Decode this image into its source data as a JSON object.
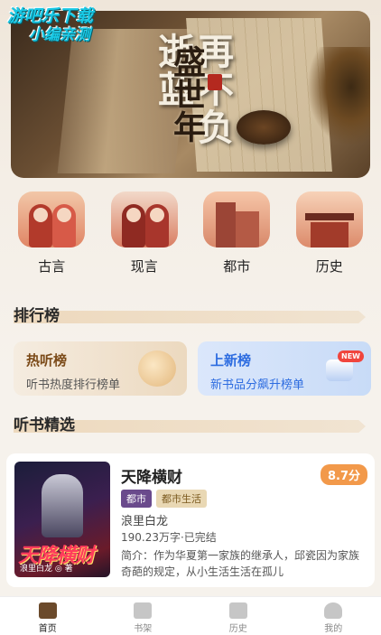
{
  "watermark": {
    "line1": "游吧乐下载",
    "line2": "小编亲测"
  },
  "banner": {
    "title_part1": "再不负",
    "title_part2": "逝",
    "title_part3": "蓝",
    "title_vertical_2": "盛世年"
  },
  "categories": [
    {
      "label": "古言",
      "icon": "ancient-couple-thumb"
    },
    {
      "label": "现言",
      "icon": "modern-couple-thumb"
    },
    {
      "label": "都市",
      "icon": "city-buildings-thumb"
    },
    {
      "label": "历史",
      "icon": "palace-thumb"
    }
  ],
  "sections": {
    "ranking": "排行榜",
    "picks": "听书精选"
  },
  "ranking_cards": [
    {
      "title": "热听榜",
      "subtitle": "听书热度排行榜单",
      "icon": "trophy-icon"
    },
    {
      "title": "上新榜",
      "subtitle": "新书品分飙升榜单",
      "icon": "new-box-icon",
      "badge": "NEW"
    }
  ],
  "book": {
    "title": "天降横财",
    "score": "8.7分",
    "tags": [
      "都市",
      "都市生活"
    ],
    "author": "浪里白龙",
    "meta": "190.23万字·已完结",
    "description": "简介：作为华夏第一家族的继承人，邱瓷因为家族奇葩的规定，从小生活生活在孤儿",
    "cover_title": "天降横财",
    "cover_author": "浪里白龙 ◎ 著"
  },
  "tabbar": [
    {
      "label": "首页",
      "active": true,
      "icon": "book-home-icon"
    },
    {
      "label": "书架",
      "active": false,
      "icon": "bookshelf-icon"
    },
    {
      "label": "历史",
      "active": false,
      "icon": "history-book-icon"
    },
    {
      "label": "我的",
      "active": false,
      "icon": "profile-icon"
    }
  ],
  "colors": {
    "accent": "#f2994a",
    "new_blue": "#2d6ce0",
    "brown": "#7b4a18"
  }
}
